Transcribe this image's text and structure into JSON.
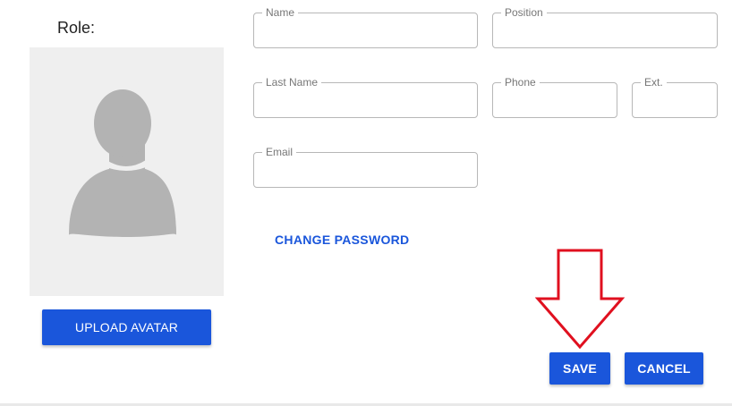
{
  "profile": {
    "role_label": "Role:",
    "upload_avatar_label": "UPLOAD AVATAR"
  },
  "form": {
    "name": {
      "label": "Name",
      "value": ""
    },
    "position": {
      "label": "Position",
      "value": ""
    },
    "last_name": {
      "label": "Last Name",
      "value": ""
    },
    "phone": {
      "label": "Phone",
      "value": ""
    },
    "ext": {
      "label": "Ext.",
      "value": ""
    },
    "email": {
      "label": "Email",
      "value": ""
    },
    "change_password_label": "CHANGE PASSWORD"
  },
  "actions": {
    "save_label": "SAVE",
    "cancel_label": "CANCEL"
  },
  "annotation": {
    "arrow_icon": "down-arrow-icon",
    "arrow_color": "#e0101f"
  },
  "colors": {
    "primary": "#1a56db",
    "avatar_bg": "#efefef",
    "avatar_silhouette": "#b3b3b3"
  }
}
